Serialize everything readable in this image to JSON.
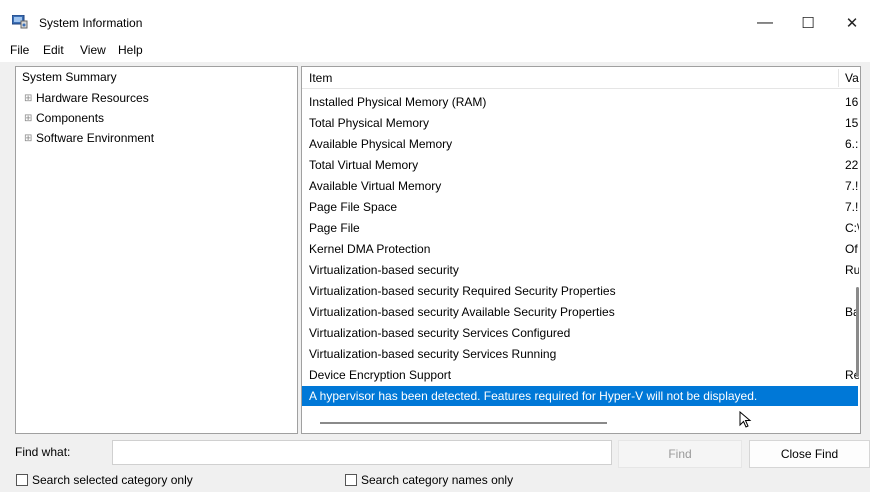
{
  "window": {
    "title": "System Information",
    "minimize_glyph": "—",
    "maximize_glyph": "☐",
    "close_glyph": "✕"
  },
  "menu": [
    "File",
    "Edit",
    "View",
    "Help"
  ],
  "tree": {
    "root": "System Summary",
    "children": [
      "Hardware Resources",
      "Components",
      "Software Environment"
    ],
    "expander": "⊞"
  },
  "table": {
    "headers": {
      "item": "Item",
      "value": "Va"
    },
    "rows": [
      {
        "item": "Installed Physical Memory (RAM)",
        "value": "16"
      },
      {
        "item": "Total Physical Memory",
        "value": "15"
      },
      {
        "item": "Available Physical Memory",
        "value": "6.:"
      },
      {
        "item": "Total Virtual Memory",
        "value": "22"
      },
      {
        "item": "Available Virtual Memory",
        "value": "7.!"
      },
      {
        "item": "Page File Space",
        "value": "7.!"
      },
      {
        "item": "Page File",
        "value": "C:\\"
      },
      {
        "item": "Kernel DMA Protection",
        "value": "Of"
      },
      {
        "item": "Virtualization-based security",
        "value": "Ru"
      },
      {
        "item": "Virtualization-based security Required Security Properties",
        "value": ""
      },
      {
        "item": "Virtualization-based security Available Security Properties",
        "value": "Ba"
      },
      {
        "item": "Virtualization-based security Services Configured",
        "value": ""
      },
      {
        "item": "Virtualization-based security Services Running",
        "value": ""
      },
      {
        "item": "Device Encryption Support",
        "value": "Re"
      },
      {
        "item": "A hypervisor has been detected. Features required for Hyper-V will not be displayed.",
        "value": ""
      }
    ],
    "selected_row_index": 14
  },
  "find": {
    "label": "Find what:",
    "value": "",
    "find_button": "Find",
    "close_find_button": "Close Find",
    "search_selected_label": "Search selected category only",
    "search_names_label": "Search category names only"
  },
  "colors": {
    "selection": "#0078d7",
    "disabled_text": "#9a9a9a"
  }
}
